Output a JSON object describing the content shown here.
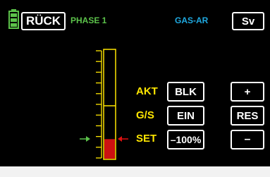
{
  "header": {
    "back_label": "RÜCK",
    "phase_label": "PHASE 1",
    "function_title": "GAS-AR",
    "sv_label": "Sv",
    "battery_icon": "battery-icon"
  },
  "rows": [
    {
      "label": "AKT",
      "value": "BLK",
      "action": "+"
    },
    {
      "label": "G/S",
      "value": "EIN",
      "action": "RES"
    },
    {
      "label": "SET",
      "value": "–100%",
      "action": "–"
    }
  ],
  "gauge": {
    "set_value_percent": -100,
    "fill_fraction": 0.18,
    "left_marker_icon": "arrow-right-icon",
    "right_marker_icon": "arrow-left-icon"
  },
  "colors": {
    "background": "#000000",
    "phase": "#5cc24a",
    "title": "#1fa9e0",
    "label": "#ffe600",
    "gauge_frame": "#ffe600",
    "gauge_fill": "#cc1111",
    "arrow_left": "#5cc24a",
    "arrow_right": "#e01010",
    "button_border": "#ffffff",
    "battery": "#5cc24a"
  }
}
